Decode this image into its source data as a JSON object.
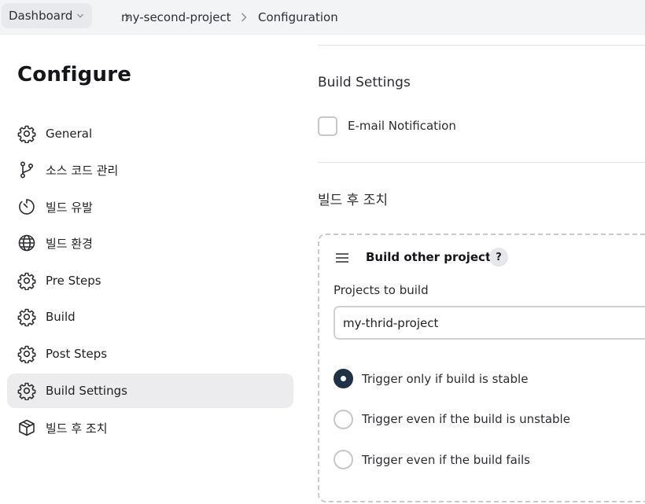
{
  "breadcrumb": {
    "items": [
      "Dashboard",
      "my-second-project",
      "Configuration"
    ]
  },
  "sidebar": {
    "title": "Configure",
    "active_item": "Build Settings",
    "items": [
      {
        "label": "General",
        "icon": "gear-icon"
      },
      {
        "label": "소스 코드 관리",
        "icon": "git-branch-icon"
      },
      {
        "label": "빌드 유발",
        "icon": "timer-icon"
      },
      {
        "label": "빌드 환경",
        "icon": "globe-icon"
      },
      {
        "label": "Pre Steps",
        "icon": "gear-icon"
      },
      {
        "label": "Build",
        "icon": "gear-icon"
      },
      {
        "label": "Post Steps",
        "icon": "gear-icon"
      },
      {
        "label": "Build Settings",
        "icon": "gear-icon"
      },
      {
        "label": "빌드 후 조치",
        "icon": "package-icon"
      }
    ]
  },
  "build_settings": {
    "title": "Build Settings",
    "email_notification": {
      "label": "E-mail Notification",
      "checked": false
    }
  },
  "post_build": {
    "title": "빌드 후 조치",
    "step": {
      "title": "Build other projects",
      "help": "?",
      "projects_label": "Projects to build",
      "projects_value": "my-thrid-project",
      "options": [
        {
          "label": "Trigger only if build is stable",
          "checked": true
        },
        {
          "label": "Trigger even if the build is unstable",
          "checked": false
        },
        {
          "label": "Trigger even if the build fails",
          "checked": false
        }
      ]
    }
  },
  "colors": {
    "accent": "#1f3347",
    "active_bg": "#ececee",
    "topbar_bg": "#f3f4f6"
  }
}
